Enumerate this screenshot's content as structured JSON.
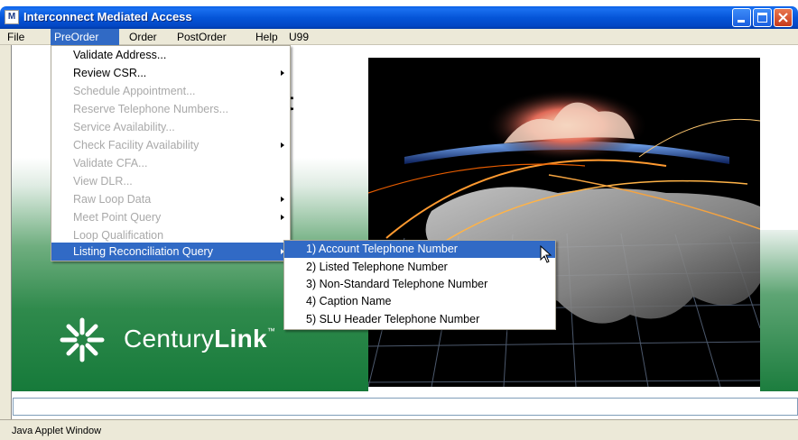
{
  "window": {
    "title": "Interconnect Mediated Access",
    "icon": "app-icon",
    "icon_text": "M"
  },
  "menubar": [
    "File",
    "PreOrder",
    "Order",
    "PostOrder",
    "Help",
    "U99"
  ],
  "preorder_menu": [
    {
      "label": "Validate Address...",
      "enabled": true,
      "submenu": false
    },
    {
      "label": "Review CSR...",
      "enabled": true,
      "submenu": true
    },
    {
      "label": "Schedule Appointment...",
      "enabled": false,
      "submenu": false
    },
    {
      "label": "Reserve Telephone Numbers...",
      "enabled": false,
      "submenu": false
    },
    {
      "label": "Service Availability...",
      "enabled": false,
      "submenu": false
    },
    {
      "label": "Check Facility Availability",
      "enabled": false,
      "submenu": true
    },
    {
      "label": "Validate CFA...",
      "enabled": false,
      "submenu": false
    },
    {
      "label": "View DLR...",
      "enabled": false,
      "submenu": false
    },
    {
      "label": "Raw Loop Data",
      "enabled": false,
      "submenu": true
    },
    {
      "label": "Meet Point Query",
      "enabled": false,
      "submenu": true
    },
    {
      "label": "Loop Qualification",
      "enabled": false,
      "submenu": false
    },
    {
      "label": "Listing Reconciliation Query",
      "enabled": true,
      "submenu": true,
      "highlighted": true
    }
  ],
  "submenu": [
    {
      "label": "1) Account Telephone Number",
      "highlighted": true
    },
    {
      "label": "2) Listed Telephone Number"
    },
    {
      "label": "3) Non-Standard Telephone Number"
    },
    {
      "label": "4) Caption Name"
    },
    {
      "label": "5) SLU Header Telephone Number"
    }
  ],
  "background_text": "t",
  "logo": {
    "light": "Century",
    "bold": "Link",
    "mark": "™"
  },
  "status_text": "Java Applet Window",
  "colors": {
    "titlebar": "#0555d8",
    "highlight": "#316ac5",
    "menubar": "#ece9d8",
    "brand_green": "#167a3a"
  }
}
